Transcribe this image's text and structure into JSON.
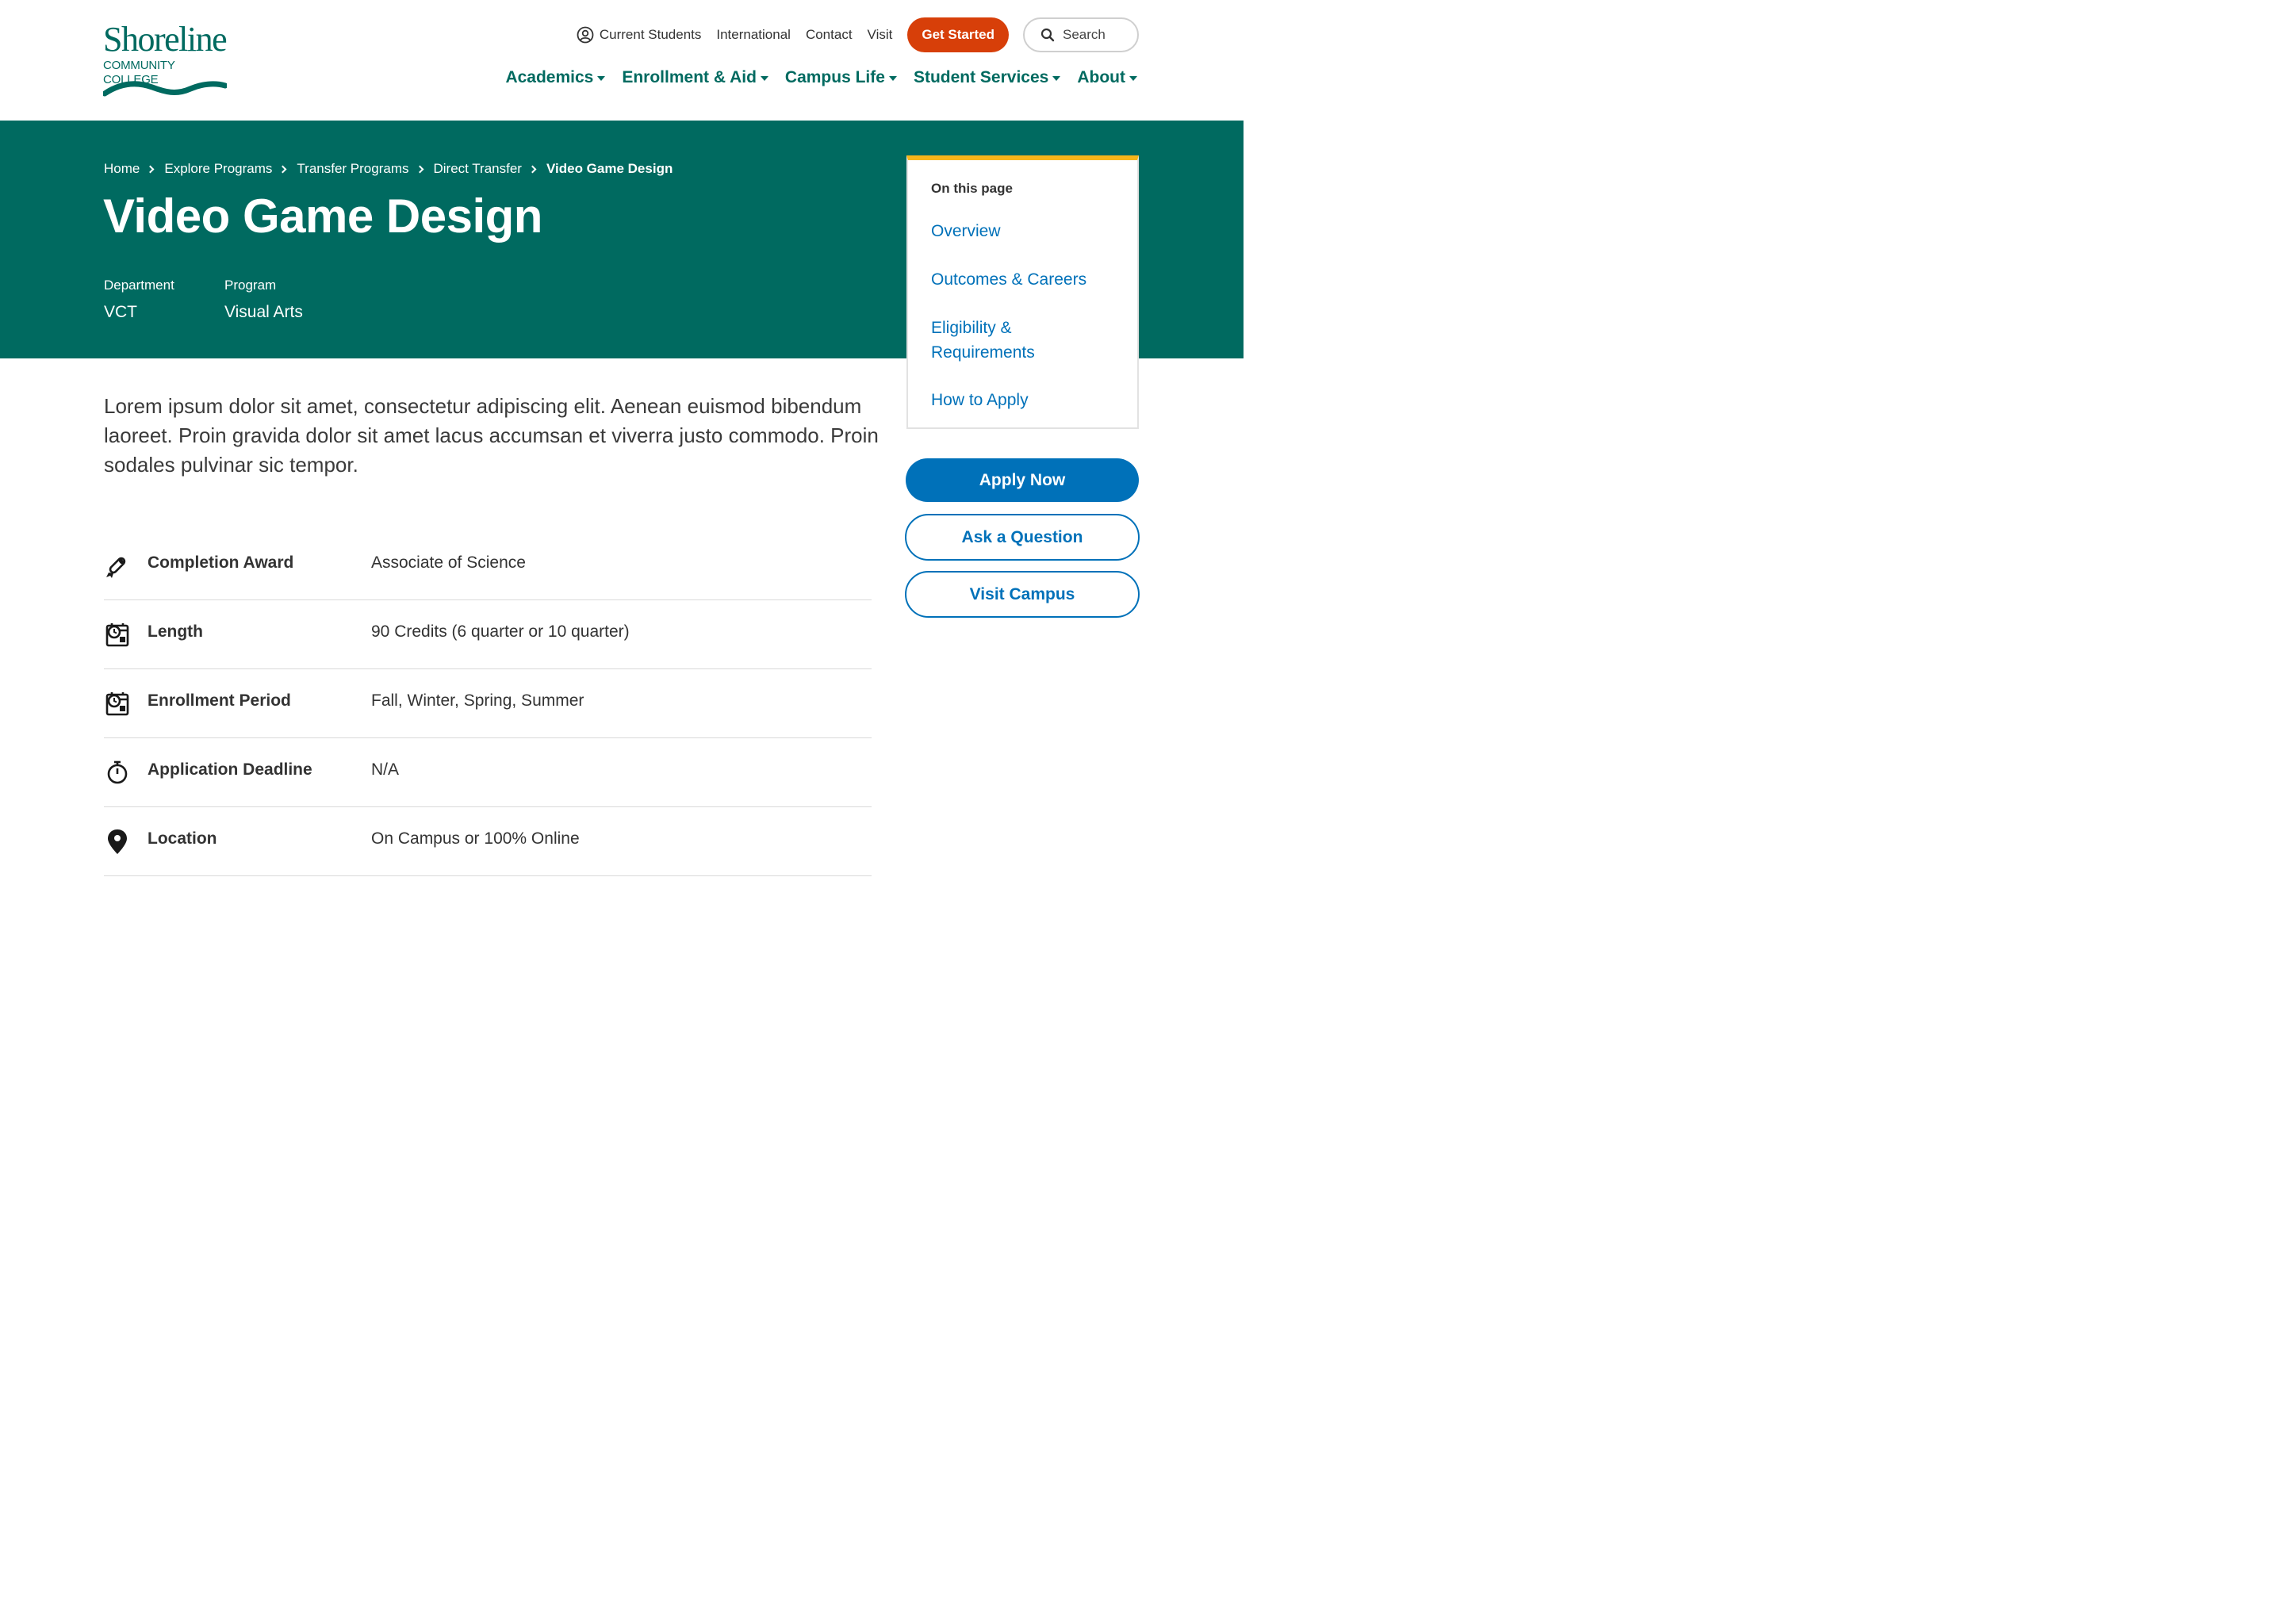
{
  "logo": {
    "wordmark": "Shoreline",
    "subtitle": "COMMUNITY COLLEGE"
  },
  "utility_nav": {
    "current_students": "Current Students",
    "international": "International",
    "contact": "Contact",
    "visit": "Visit",
    "get_started": "Get Started",
    "search": "Search"
  },
  "main_nav": [
    "Academics",
    "Enrollment & Aid",
    "Campus Life",
    "Student Services",
    "About"
  ],
  "breadcrumb": [
    "Home",
    "Explore Programs",
    "Transfer Programs",
    "Direct Transfer",
    "Video Game Design"
  ],
  "page": {
    "title": "Video Game Design",
    "department_label": "Department",
    "department_value": "VCT",
    "program_label": "Program",
    "program_value": "Visual Arts",
    "intro": "Lorem ipsum dolor sit amet, consectetur adipiscing elit. Aenean euismod bibendum laoreet. Proin gravida dolor sit amet lacus accumsan et viverra justo commodo. Proin sodales pulvinar sic tempor."
  },
  "toc": {
    "title": "On this page",
    "items": [
      "Overview",
      "Outcomes & Careers",
      "Eligibility & Requirements",
      "How to Apply"
    ]
  },
  "details": [
    {
      "icon": "diploma-icon",
      "label": "Completion Award",
      "value": "Associate of Science"
    },
    {
      "icon": "calendar-clock-icon",
      "label": "Length",
      "value": "90 Credits (6 quarter or 10 quarter)"
    },
    {
      "icon": "calendar-clock-icon",
      "label": "Enrollment Period",
      "value": "Fall, Winter, Spring, Summer"
    },
    {
      "icon": "stopwatch-icon",
      "label": "Application Deadline",
      "value": "N/A"
    },
    {
      "icon": "location-pin-icon",
      "label": "Location",
      "value": "On Campus or 100% Online"
    }
  ],
  "cta": {
    "apply": "Apply Now",
    "ask": "Ask a Question",
    "visit": "Visit Campus"
  },
  "colors": {
    "brand_green": "#006a60",
    "accent_orange": "#d73f09",
    "link_blue": "#0071b9",
    "toc_accent": "#f6b51a"
  }
}
